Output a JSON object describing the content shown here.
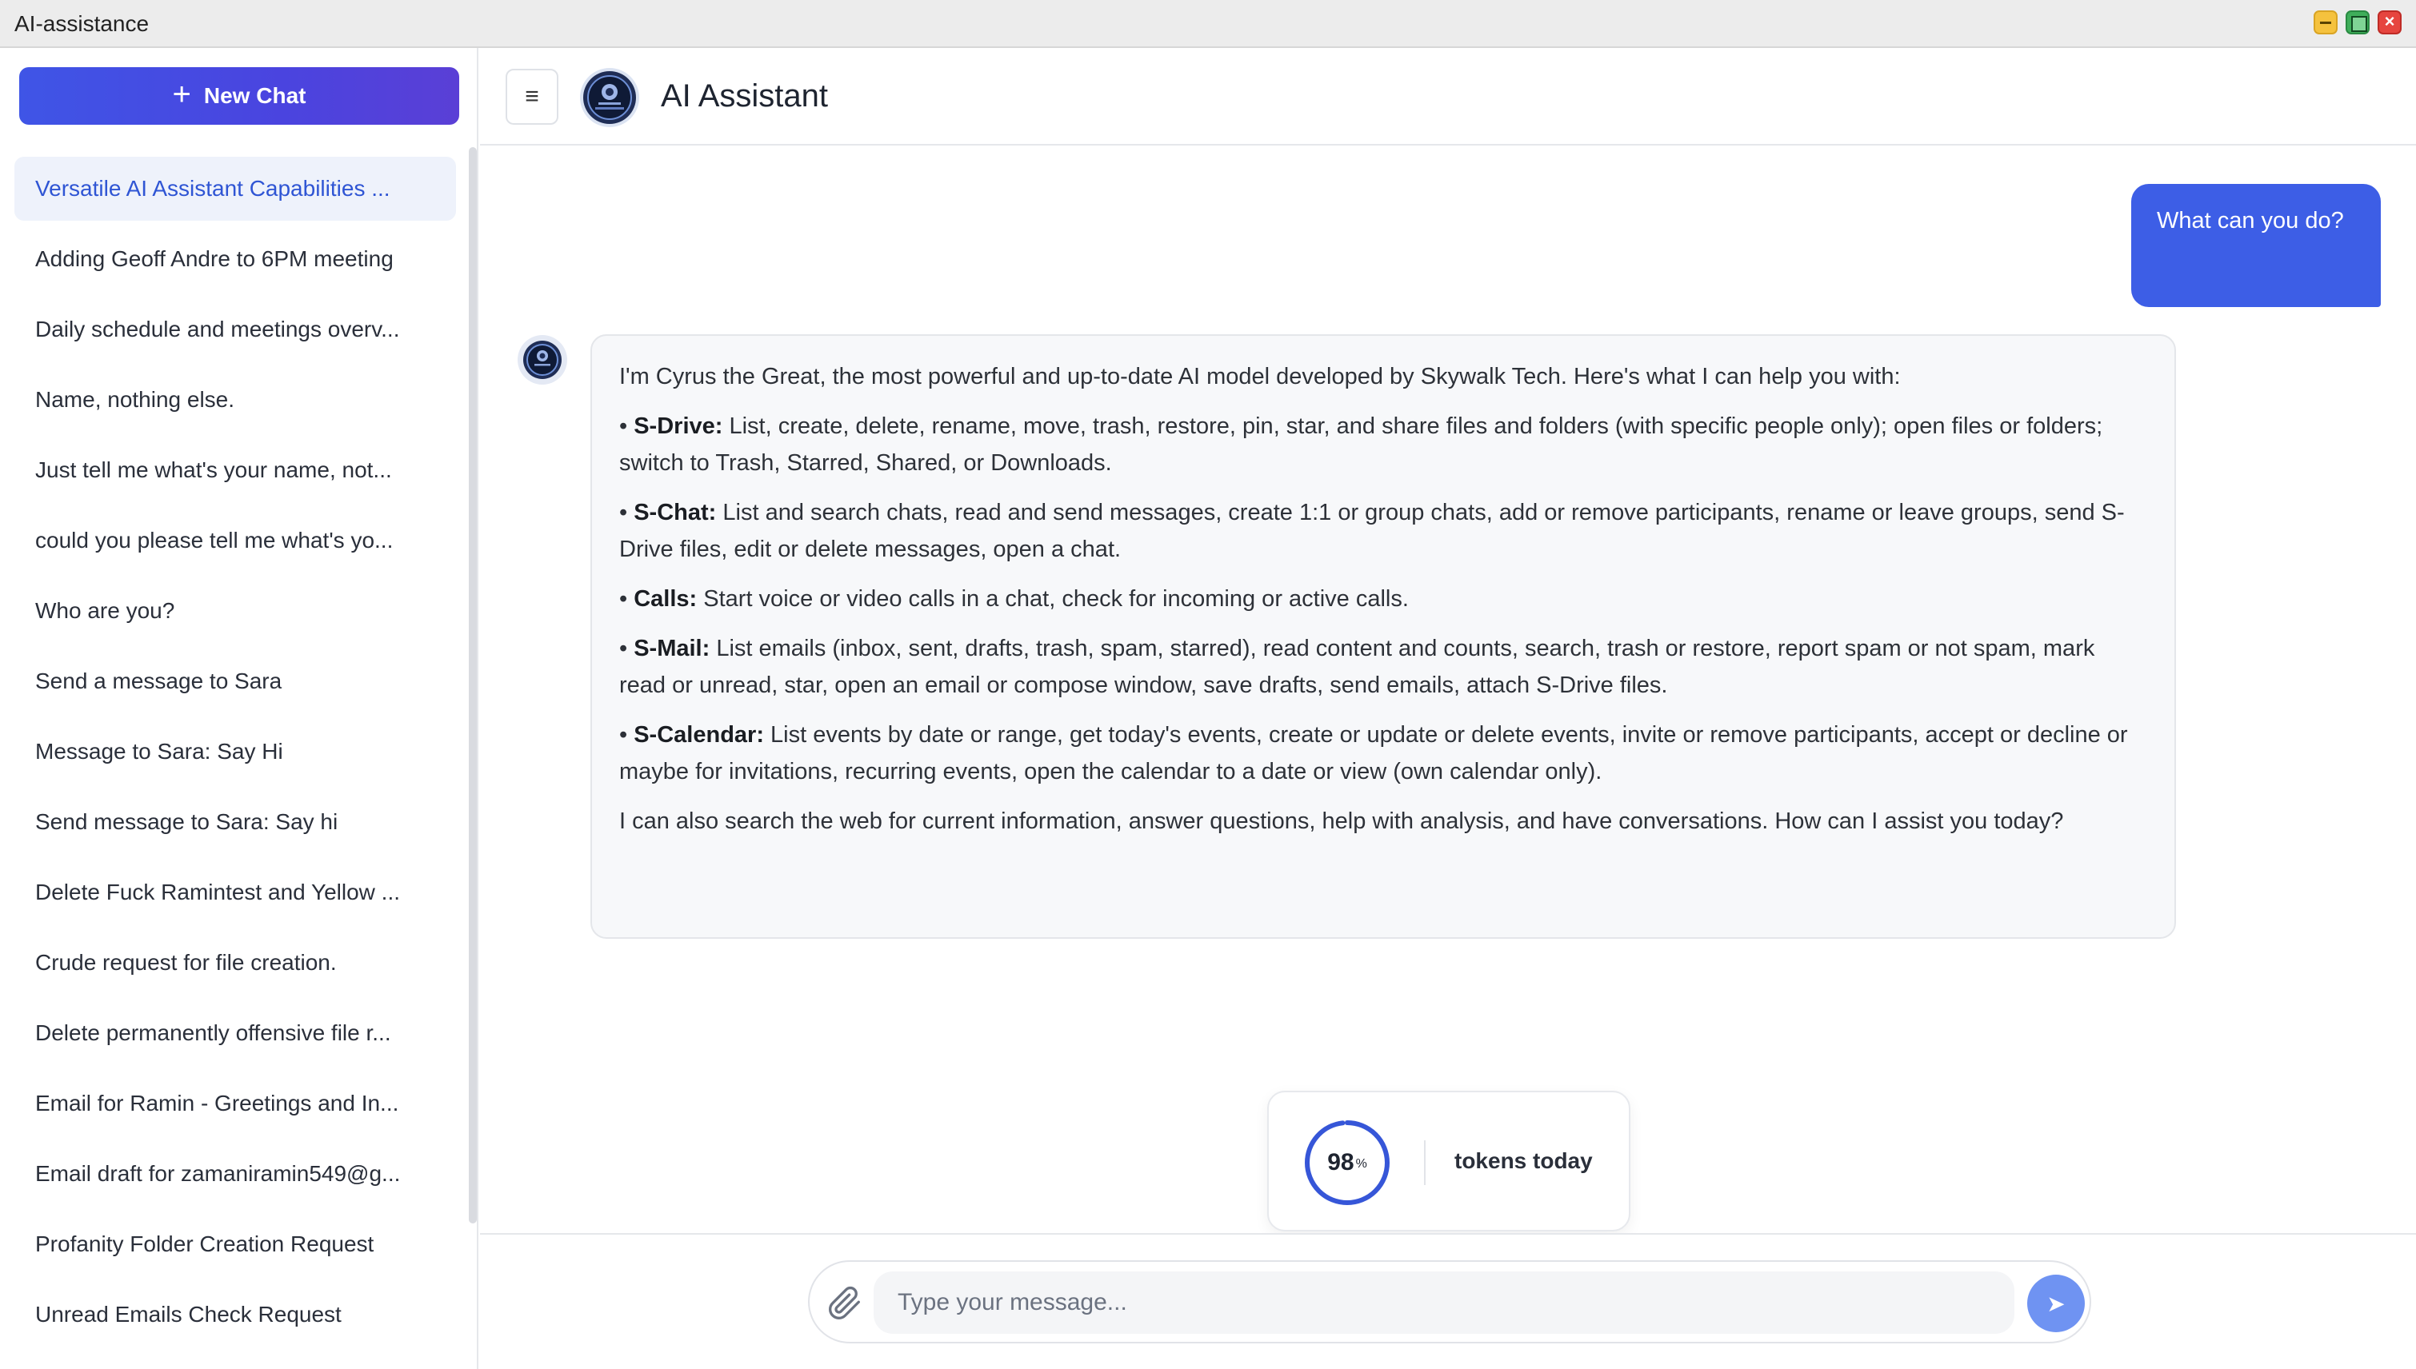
{
  "window": {
    "title": "AI-assistance"
  },
  "sidebar": {
    "new_chat_label": "New Chat",
    "items": [
      {
        "label": "Versatile AI Assistant Capabilities ...",
        "active": true
      },
      {
        "label": "Adding Geoff Andre to 6PM meeting"
      },
      {
        "label": "Daily schedule and meetings overv..."
      },
      {
        "label": "Name, nothing else."
      },
      {
        "label": "Just tell me what's your name, not..."
      },
      {
        "label": "could you please tell me what's yo..."
      },
      {
        "label": "Who are you?"
      },
      {
        "label": "Send a message to Sara"
      },
      {
        "label": "Message to Sara: Say Hi"
      },
      {
        "label": "Send message to Sara: Say hi"
      },
      {
        "label": "Delete Fuck Ramintest and Yellow ..."
      },
      {
        "label": "Crude request for file creation."
      },
      {
        "label": "Delete permanently offensive file r..."
      },
      {
        "label": "Email for Ramin - Greetings and In..."
      },
      {
        "label": "Email draft for zamaniramin549@g..."
      },
      {
        "label": "Profanity Folder Creation Request"
      },
      {
        "label": "Unread Emails Check Request"
      }
    ]
  },
  "header": {
    "title": "AI Assistant"
  },
  "conversation": {
    "user_message": "What can you do?",
    "ai_intro": "I'm Cyrus the Great, the most powerful and up-to-date AI model developed by Skywalk Tech. Here's what I can help you with:",
    "capabilities": [
      {
        "name": "S-Drive:",
        "text": " List, create, delete, rename, move, trash, restore, pin, star, and share files and folders (with specific people only); open files or folders; switch to Trash, Starred, Shared, or Downloads."
      },
      {
        "name": "S-Chat:",
        "text": " List and search chats, read and send messages, create 1:1 or group chats, add or remove participants, rename or leave groups, send S-Drive files, edit or delete messages, open a chat."
      },
      {
        "name": "Calls:",
        "text": " Start voice or video calls in a chat, check for incoming or active calls."
      },
      {
        "name": "S-Mail:",
        "text": " List emails (inbox, sent, drafts, trash, spam, starred), read content and counts, search, trash or restore, report spam or not spam, mark read or unread, star, open an email or compose window, save drafts, send emails, attach S-Drive files."
      },
      {
        "name": "S-Calendar:",
        "text": " List events by date or range, get today's events, create or update or delete events, invite or remove participants, accept or decline or maybe for invitations, recurring events, open the calendar to a date or view (own calendar only)."
      }
    ],
    "ai_outro": "I can also search the web for current information, answer questions, help with analysis, and have conversations. How can I assist you today?"
  },
  "tokens": {
    "value": "98",
    "unit": "%",
    "percent": 98,
    "label": "tokens today"
  },
  "composer": {
    "placeholder": "Type your message...",
    "send_icon": "➤"
  },
  "colors": {
    "accent": "#3d5ee6",
    "active_item_text": "#2f55d4",
    "ring": "#3656d8"
  }
}
